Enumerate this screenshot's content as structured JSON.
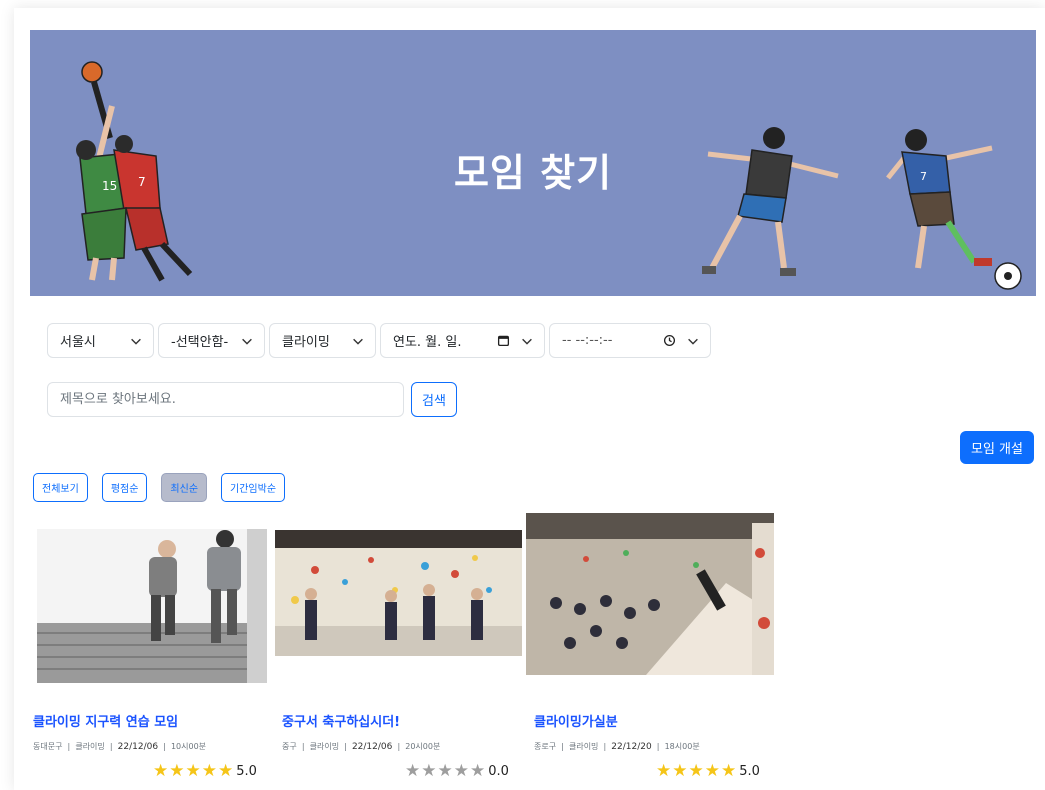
{
  "hero": {
    "title": "모임 찾기"
  },
  "filters": {
    "city": "서울시",
    "district": "-선택안함-",
    "category": "클라이밍",
    "date_placeholder": "연도. 월. 일.",
    "time_placeholder": "-- --:--:--"
  },
  "search": {
    "placeholder": "제목으로 찾아보세요.",
    "button_label": "검색"
  },
  "create_button": "모임 개설",
  "sort_buttons": [
    {
      "label": "전체보기",
      "active": false
    },
    {
      "label": "평점순",
      "active": false
    },
    {
      "label": "최신순",
      "active": true
    },
    {
      "label": "기간임박순",
      "active": false
    }
  ],
  "cards": [
    {
      "title": "클라이밍 지구력 연습 모임",
      "district": "동대문구",
      "category": "클라이밍",
      "date": "22/12/06",
      "time": "10시00분",
      "stars": 5,
      "score": "5.0"
    },
    {
      "title": "중구서 축구하십시더!",
      "district": "중구",
      "category": "클라이밍",
      "date": "22/12/06",
      "time": "20시00분",
      "stars": 0,
      "score": "0.0"
    },
    {
      "title": "클라이밍가실분",
      "district": "종로구",
      "category": "클라이밍",
      "date": "22/12/20",
      "time": "18시00분",
      "stars": 5,
      "score": "5.0"
    }
  ],
  "colors": {
    "hero_bg": "#7e8fc2",
    "primary": "#0d6efd",
    "title_blue": "#1a53ff",
    "star_gold": "#f5c518",
    "star_gray": "#9e9e9e"
  }
}
